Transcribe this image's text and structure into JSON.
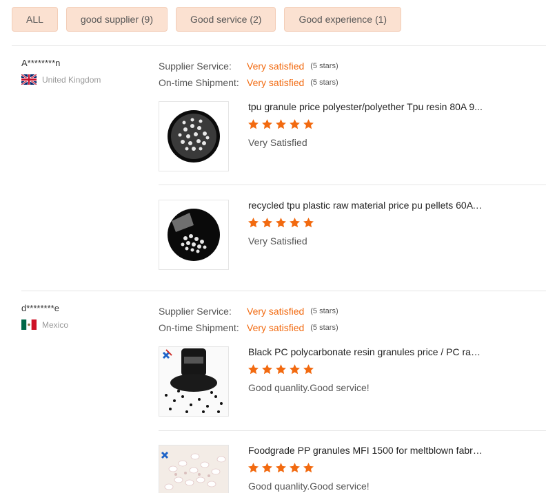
{
  "filters": [
    {
      "label": "ALL"
    },
    {
      "label": "good supplier (9)"
    },
    {
      "label": "Good service (2)"
    },
    {
      "label": "Good experience (1)"
    }
  ],
  "reviews": [
    {
      "user": "A********n",
      "country": "United Kingdom",
      "flag": "uk-flag-icon",
      "supplier_service": {
        "label": "Supplier Service:",
        "value": "Very satisfied",
        "stars": "(5 stars)"
      },
      "shipment": {
        "label": "On-time Shipment:",
        "value": "Very satisfied",
        "stars": "(5 stars)"
      },
      "products": [
        {
          "title": "tpu granule price polyester/polyether Tpu resin 80A 9...",
          "rating": 5,
          "comment": "Very Satisfied"
        },
        {
          "title": "recycled tpu plastic raw material price pu pellets 60A ...",
          "rating": 5,
          "comment": "Very Satisfied"
        }
      ]
    },
    {
      "user": "d********e",
      "country": "Mexico",
      "flag": "mexico-flag-icon",
      "supplier_service": {
        "label": "Supplier Service:",
        "value": "Very satisfied",
        "stars": "(5 stars)"
      },
      "shipment": {
        "label": "On-time Shipment:",
        "value": "Very satisfied",
        "stars": "(5 stars)"
      },
      "products": [
        {
          "title": "Black PC polycarbonate resin granules price / PC raw ...",
          "rating": 5,
          "comment": "Good quanlity.Good service!"
        },
        {
          "title": "Foodgrade PP granules MFI 1500 for meltblown fabri...",
          "rating": 5,
          "comment": "Good quanlity.Good service!"
        }
      ]
    }
  ],
  "colors": {
    "accent": "#f26a10",
    "chip_bg": "#fbe1d1"
  }
}
